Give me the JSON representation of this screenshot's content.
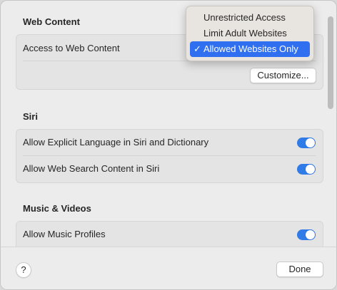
{
  "web_content": {
    "title": "Web Content",
    "access_label": "Access to Web Content",
    "customize_label": "Customize..."
  },
  "siri": {
    "title": "Siri",
    "rows": [
      {
        "label": "Allow Explicit Language in Siri and Dictionary",
        "enabled": true
      },
      {
        "label": "Allow Web Search Content in Siri",
        "enabled": true
      }
    ]
  },
  "music_videos": {
    "title": "Music & Videos",
    "rows": [
      {
        "label": "Allow Music Profiles",
        "enabled": true
      }
    ]
  },
  "dropdown": {
    "options": [
      "Unrestricted Access",
      "Limit Adult Websites",
      "Allowed Websites Only"
    ],
    "selected": "Allowed Websites Only",
    "check_glyph": "✓"
  },
  "footer": {
    "help_label": "?",
    "done_label": "Done"
  },
  "colors": {
    "accent": "#2f7be8",
    "menu_highlight": "#2f6ff0"
  },
  "icons": [
    "checkmark-icon",
    "toggle-switch"
  ]
}
